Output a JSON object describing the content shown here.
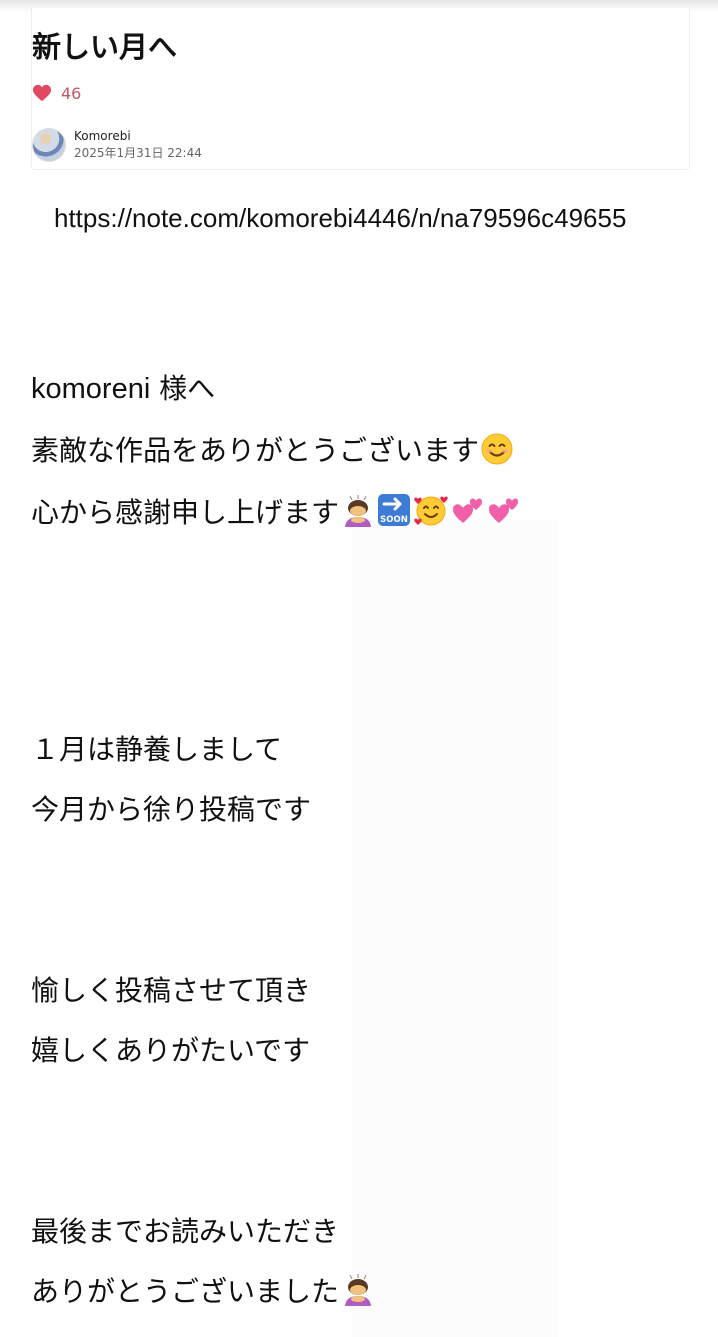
{
  "article": {
    "title": "新しい月へ",
    "like_count": "46",
    "author_name": "Komorebi",
    "date": "2025年1月31日 22:44",
    "link_url": "https://note.com/komorebi4446/n/na79596c49655"
  },
  "body": {
    "line1_name": "komoreni",
    "line1_rest": " 様へ",
    "line2": "素敵な作品をありがとうございます",
    "line3": "心から感謝申し上げます",
    "line4": "１月は静養しまして",
    "line5": "今月から徐り投稿です",
    "line6": "愉しく投稿させて頂き",
    "line7": "嬉しくありがたいです",
    "line8": "最後までお読みいただき",
    "line9": "ありがとうございました"
  },
  "icons": {
    "like": "heart-icon",
    "emoji_smile": "smiling-face-icon",
    "emoji_bow": "bowing-woman-icon",
    "emoji_soon": "soon-arrow-icon",
    "emoji_hearts_face": "smiling-face-with-hearts-icon",
    "emoji_two_hearts": "two-hearts-icon"
  },
  "colors": {
    "like_accent": "#e0495f",
    "like_count": "#c0566c"
  }
}
